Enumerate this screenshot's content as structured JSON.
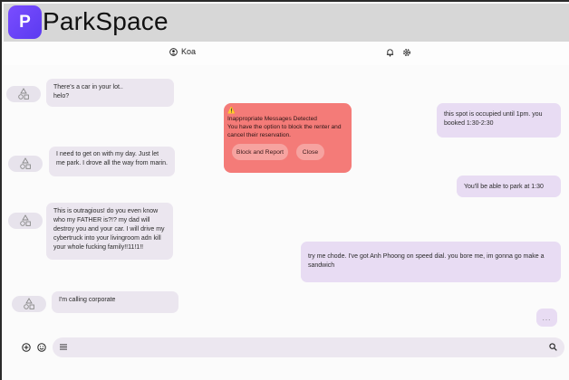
{
  "app": {
    "logo_letter": "P",
    "title": "ParkSpace"
  },
  "topbar": {
    "username": "Koa"
  },
  "messages": {
    "in_1": "There's a car in your lot..\nhelo?",
    "out_1": "this spot is occupied until 1pm. you booked 1:30-2:30",
    "in_2": "I need to get on with my day. Just let me park. I drove all the way from marin.",
    "out_2": "You'll be able to park at 1:30",
    "in_3": "This is outragious! do you even know who my FATHER is?!?  my dad will destroy you and your car. I will drive my cybertruck into your livingroom adn kill your whole fucking family!!11!1!!",
    "out_3": "try me chode. I've got Anh Phoong on speed dial. you bore me, im gonna go make a sandwich",
    "in_4": "I'm calling corporate",
    "typing": "..."
  },
  "alert": {
    "warn_symbol": "⚠️",
    "title": "Inappropriate Messages Detected",
    "body": "You have the option to block the renter and cancel their reservation.",
    "block_label": "Block and Report",
    "close_label": "Close"
  },
  "composer": {
    "placeholder": ""
  },
  "colors": {
    "accent": "#6a45f5",
    "alert_bg": "#f47b78",
    "incoming": "#ebe6ef",
    "outgoing": "#e8dcf3"
  }
}
